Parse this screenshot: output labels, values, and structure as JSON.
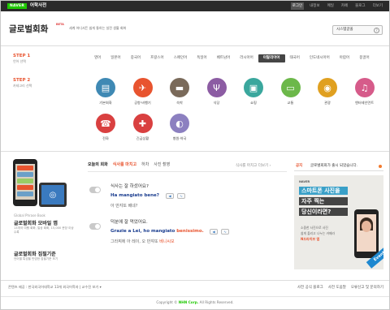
{
  "topbar": {
    "logo": "NAVER",
    "service": "어학사전",
    "links": [
      "로그인",
      "내정보",
      "메일",
      "카페",
      "블로그",
      "더보기"
    ]
  },
  "header": {
    "title": "글로벌회화",
    "beta": "BETA",
    "tagline": "세계 어디서든 쉽게 통하는 실전 생활 회화",
    "button": "시스템글꼴",
    "help": "?"
  },
  "steps": [
    {
      "num": "STEP 1",
      "sub": "언어 선택"
    },
    {
      "num": "STEP 2",
      "sub": "카테고리 선택"
    }
  ],
  "languages": [
    "영어",
    "일본어",
    "중국어",
    "프랑스어",
    "스페인어",
    "독일어",
    "베트남어",
    "러시아어",
    "이탈리아어",
    "태국어",
    "인도네시아어",
    "아랍어",
    "몽골어"
  ],
  "selected_language_index": 8,
  "categories": [
    {
      "label": "기본회화",
      "icon": "speech-bubble-icon",
      "color": "#3f89b4"
    },
    {
      "label": "공항·비행기",
      "icon": "airplane-icon",
      "color": "#e8542f"
    },
    {
      "label": "숙박",
      "icon": "bed-icon",
      "color": "#7a6a5a"
    },
    {
      "label": "식당",
      "icon": "fork-knife-icon",
      "color": "#8c5ca3"
    },
    {
      "label": "쇼핑",
      "icon": "shopping-bag-icon",
      "color": "#3aa79d"
    },
    {
      "label": "교통",
      "icon": "bus-icon",
      "color": "#6cb84a"
    },
    {
      "label": "관광",
      "icon": "camera-icon",
      "color": "#e0a020"
    },
    {
      "label": "엔터테인먼트",
      "icon": "music-note-icon",
      "color": "#d65b8a"
    },
    {
      "label": "전화",
      "icon": "phone-icon",
      "color": "#d94040"
    },
    {
      "label": "긴급상황",
      "icon": "first-aid-icon",
      "color": "#d94040"
    },
    {
      "label": "병원·약국",
      "icon": "pill-icon",
      "color": "#8c80c0"
    }
  ],
  "today": {
    "tabs": [
      "오늘의 회화",
      "식사를 마치고",
      "하차",
      "사진 촬영"
    ],
    "more": "식사를 마치고 더보기 ›",
    "dialogs": [
      {
        "ko": "식사는 잘 하셨어요?",
        "it": "Ha mangiato bene?",
        "tr": "아 만쟈또 베네?"
      },
      {
        "ko": "덕분에 잘 먹었어요.",
        "it_a": "Grazie a Lei, ho mangiato ",
        "it_b": "benissimo.",
        "tr_a": "그라찌에 아 레이, 오 만쟈또 ",
        "tr_b": "베니씨모"
      }
    ]
  },
  "promo": {
    "small": "Global Phrase Book",
    "title": "글로벌회화 모바일 앱",
    "desc": "13개국 여행 회화, 일상 회화, 15,000 문장 이상 수록",
    "title2": "글로벌회화 집필기준",
    "desc2": "언어별 특성을 반영한 집필기준 보기"
  },
  "notice": {
    "label": "공지",
    "text": "글로벌회화가 출시 되었습니다."
  },
  "ad": {
    "brand": "NAVER",
    "line1": "스마트폰 사진을",
    "line2": "자주 찍는",
    "line3": "당신이라면?",
    "d1": "소중한 사진으로 사진",
    "d2": "쉽게 올리고 나누는 카메라",
    "d3": "N드라이브 앱",
    "event": "Event"
  },
  "footer": {
    "left": "콘텐츠 제공 : 한국외국어대학교 13개 외국어학과  |  교수진 보기 ▾",
    "right": [
      "사전 공식 블로그",
      "사전 도움말",
      "오류신고 및 문의하기"
    ],
    "copyright_pre": "Copyright ©",
    "copyright_brand": "NHN Corp.",
    "copyright_post": "All Rights Reserved."
  }
}
